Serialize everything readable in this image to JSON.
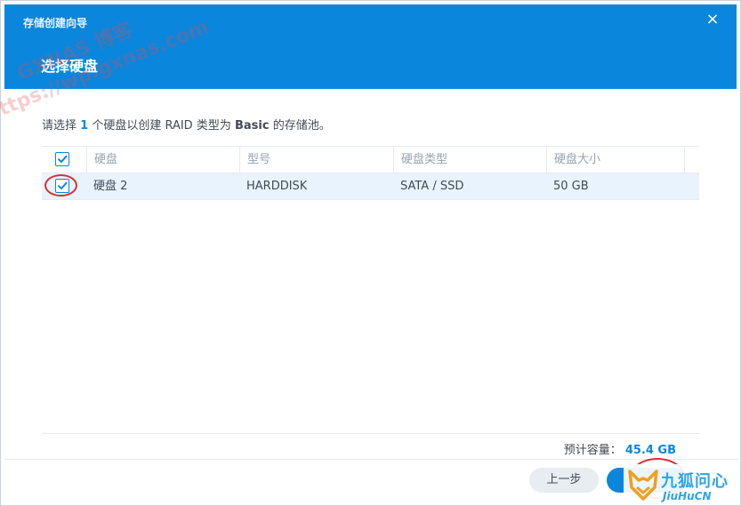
{
  "window": {
    "title": "存储创建向导",
    "close_icon": "×",
    "step_title": "选择硬盘"
  },
  "description": {
    "prefix": "请选择 ",
    "count": "1",
    "middle": " 个硬盘以创建 RAID 类型为 ",
    "raid_type": "Basic",
    "suffix": " 的存储池。"
  },
  "table": {
    "columns": [
      "硬盘",
      "型号",
      "硬盘类型",
      "硬盘大小"
    ],
    "header_checked": true,
    "rows": [
      {
        "checked": true,
        "disk": "硬盘 2",
        "model": "HARDDISK",
        "type": "SATA / SSD",
        "size": "50 GB"
      }
    ]
  },
  "capacity": {
    "label": "预计容量：",
    "value": "45.4 GB"
  },
  "footer": {
    "prev_label": "上一步",
    "next_label": ""
  },
  "watermark": {
    "line1": "GXNAS 博客",
    "line2": "https://wp.gxnas.com"
  },
  "logo": {
    "cn": "九狐问心",
    "en": "JiuHuCN"
  },
  "colors": {
    "accent": "#0a86dd",
    "highlight_row": "#e9f3fd",
    "annotation": "#d8303a"
  }
}
